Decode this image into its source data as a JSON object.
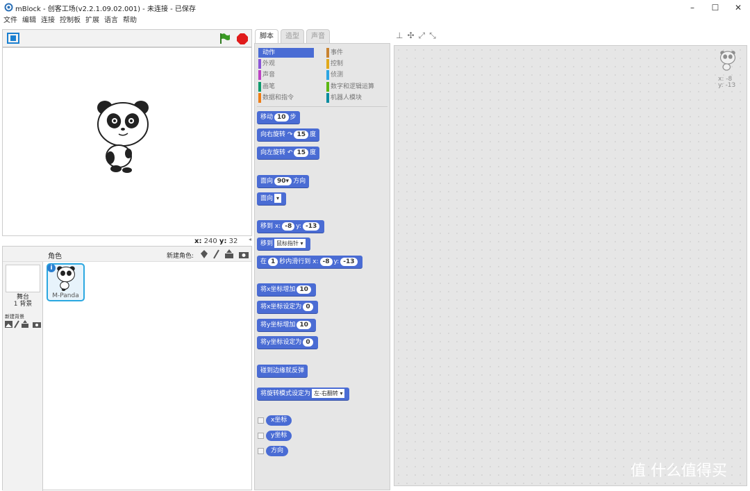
{
  "window": {
    "title": "mBlock - 创客工场(v2.2.1.09.02.001) - 未连接 - 已保存",
    "minimize": "–",
    "maximize": "☐",
    "close": "✕"
  },
  "menu": [
    "文件",
    "编辑",
    "连接",
    "控制板",
    "扩展",
    "语言",
    "帮助"
  ],
  "stage": {
    "coords": {
      "x_label": "x:",
      "x_value": "240",
      "y_label": "y:",
      "y_value": "32"
    }
  },
  "sprites": {
    "header_label": "角色",
    "new_sprite_label": "新建角色:",
    "stage_label": "舞台",
    "backdrop_count": "1 背景",
    "new_backdrop_label": "新建背景",
    "sprite_name": "M-Panda",
    "info_badge": "i"
  },
  "tabs": [
    "脚本",
    "造型",
    "声音"
  ],
  "categories": {
    "left": [
      {
        "label": "动作",
        "color": "#4a6cd4"
      },
      {
        "label": "外观",
        "color": "#8a55d7"
      },
      {
        "label": "声音",
        "color": "#bb42c3"
      },
      {
        "label": "画笔",
        "color": "#0e9a6c"
      },
      {
        "label": "数据和指令",
        "color": "#ee7d16"
      }
    ],
    "right": [
      {
        "label": "事件",
        "color": "#c88330"
      },
      {
        "label": "控制",
        "color": "#e1a91a"
      },
      {
        "label": "侦测",
        "color": "#2ca5e2"
      },
      {
        "label": "数字和逻辑运算",
        "color": "#5cb712"
      },
      {
        "label": "机器人模块",
        "color": "#0a8ca0"
      }
    ]
  },
  "blocks": {
    "move": {
      "a": "移动",
      "v": "10",
      "b": "步"
    },
    "turn_right": {
      "a": "向右旋转",
      "icon": "↷",
      "v": "15",
      "b": "度"
    },
    "turn_left": {
      "a": "向左旋转",
      "icon": "↶",
      "v": "15",
      "b": "度"
    },
    "point_dir": {
      "a": "面向",
      "v": "90▾",
      "b": "方向"
    },
    "point_towards": {
      "a": "面向",
      "dd": "▾"
    },
    "goto_xy": {
      "a": "移到 x:",
      "x": "-8",
      "b": "y:",
      "y": "-13"
    },
    "goto": {
      "a": "移到",
      "dd": "鼠标指针 ▾"
    },
    "glide": {
      "a": "在",
      "t": "1",
      "b": "秒内滑行到 x:",
      "x": "-8",
      "c": "y:",
      "y": "-13"
    },
    "change_x": {
      "a": "将x坐标增加",
      "v": "10"
    },
    "set_x": {
      "a": "将x坐标设定为",
      "v": "0"
    },
    "change_y": {
      "a": "将y坐标增加",
      "v": "10"
    },
    "set_y": {
      "a": "将y坐标设定为",
      "v": "0"
    },
    "bounce": {
      "a": "碰到边缘就反弹"
    },
    "rotation_style": {
      "a": "将旋转模式设定为",
      "dd": "左-右翻转 ▾"
    },
    "reporters": [
      "x坐标",
      "y坐标",
      "方向"
    ]
  },
  "workspace": {
    "x_readout": "x: -8",
    "y_readout": "y: -13"
  },
  "watermark": "值 什么值得买"
}
